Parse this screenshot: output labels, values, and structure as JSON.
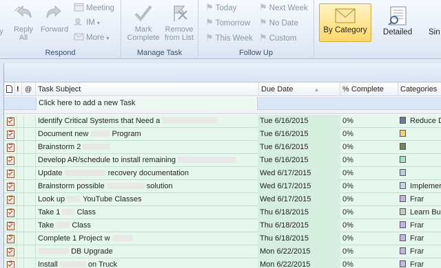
{
  "ribbon": {
    "respond": {
      "label": "Respond",
      "edge_label": "y",
      "reply_all": "Reply\nAll",
      "reply_all_l1": "Reply",
      "reply_all_l2": "All",
      "forward": "Forward",
      "meeting": "Meeting",
      "im": "IM",
      "more": "More"
    },
    "manage": {
      "label": "Manage Task",
      "mark_complete_l1": "Mark",
      "mark_complete_l2": "Complete",
      "remove_l1": "Remove",
      "remove_l2": "from List"
    },
    "followup": {
      "label": "Follow Up",
      "today": "Today",
      "tomorrow": "Tomorrow",
      "this_week": "This Week",
      "next_week": "Next Week",
      "no_date": "No Date",
      "custom": "Custom"
    },
    "views": {
      "by_category": "By Category",
      "detailed": "Detailed",
      "simple_partial": "Sin"
    }
  },
  "columns": {
    "task_subject": "Task Subject",
    "due_date": "Due Date",
    "percent_complete": "% Complete",
    "categories": "Categories"
  },
  "new_task_placeholder": "Click here to add a new Task",
  "tasks": [
    {
      "subject": "Identify Critical Systems that Need a",
      "due": "Tue 6/16/2015",
      "pct": "0%",
      "cat_color": "#6e7a96",
      "category": "Reduce D"
    },
    {
      "subject": "Document new",
      "subject_tail": "Program",
      "due": "Tue 6/16/2015",
      "pct": "0%",
      "cat_color": "#f6d26a",
      "category": ""
    },
    {
      "subject": "Brainstorm 2",
      "due": "Tue 6/16/2015",
      "pct": "0%",
      "cat_color": "#6d8a55",
      "category": ""
    },
    {
      "subject": "Develop AR/schedule to install remaining",
      "due": "Tue 6/16/2015",
      "pct": "0%",
      "cat_color": "#a8e0c8",
      "category": ""
    },
    {
      "subject": "Update",
      "subject_tail": "recovery documentation",
      "due": "Wed 6/17/2015",
      "pct": "0%",
      "cat_color": "#b9cbe3",
      "category": ""
    },
    {
      "subject": "Brainstorm possible",
      "subject_tail": "solution",
      "due": "Wed 6/17/2015",
      "pct": "0%",
      "cat_color": "#bcd6ee",
      "category": "Implemer"
    },
    {
      "subject": "Look up",
      "subject_tail": "YouTube Classes",
      "due": "Wed 6/17/2015",
      "pct": "0%",
      "cat_color": "#c4b3e6",
      "category": "Frar"
    },
    {
      "subject": "Take 1",
      "subject_tail": "Class",
      "due": "Thu 6/18/2015",
      "pct": "0%",
      "cat_color": "#c9c9c9",
      "category": "Learn Bu"
    },
    {
      "subject": "Take",
      "subject_tail": "Class",
      "due": "Thu 6/18/2015",
      "pct": "0%",
      "cat_color": "#c4b3e6",
      "category": "Frar"
    },
    {
      "subject": "Complete 1 Project w",
      "due": "Thu 6/18/2015",
      "pct": "0%",
      "cat_color": "#c4b3e6",
      "category": "Frar"
    },
    {
      "subject": "",
      "subject_tail": "DB Upgrade",
      "due": "Mon 6/22/2015",
      "pct": "0%",
      "cat_color": "#c4b3e6",
      "category": "Frar"
    },
    {
      "subject": "Install",
      "subject_tail": "on Truck",
      "due": "Mon 6/22/2015",
      "pct": "0%",
      "cat_color": "#c4b3e6",
      "category": "Frar"
    }
  ]
}
